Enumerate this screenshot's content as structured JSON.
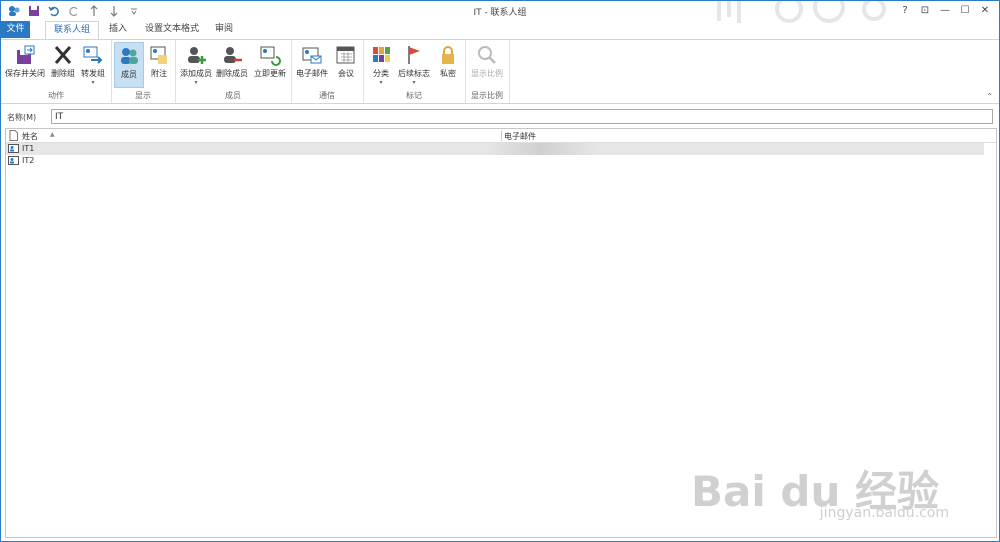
{
  "window_title": "IT - 联系人组",
  "tabs": [
    {
      "label": "文件"
    },
    {
      "label": "联系人组"
    },
    {
      "label": "插入"
    },
    {
      "label": "设置文本格式"
    },
    {
      "label": "审阅"
    }
  ],
  "window_controls": {
    "help": "?",
    "options": "⊡",
    "minimize": "—",
    "maximize": "☐",
    "close": "✕"
  },
  "ribbon": {
    "groups": {
      "actions": {
        "label": "动作",
        "save_close": "保存并关闭",
        "delete_group": "删除组",
        "forward_group": "转发组"
      },
      "show": {
        "label": "显示",
        "members": "成员",
        "notes": "附注"
      },
      "members": {
        "label": "成员",
        "add_members": "添加成员",
        "remove_member": "删除成员",
        "update_now": "立即更新"
      },
      "communicate": {
        "label": "通信",
        "email": "电子邮件",
        "meeting": "会议"
      },
      "tags": {
        "label": "标记",
        "categorize": "分类",
        "follow_up": "后续标志",
        "private": "私密"
      },
      "zoom": {
        "label": "显示比例",
        "zoom": "显示比例"
      }
    }
  },
  "name_field": {
    "label": "名称(M)",
    "value": "IT"
  },
  "list": {
    "columns": {
      "name": "姓名",
      "email": "电子邮件"
    },
    "rows": [
      {
        "name": "IT1"
      },
      {
        "name": "IT2"
      }
    ]
  },
  "watermark": {
    "main": "Bai du 经验",
    "sub": "jingyan.baidu.com"
  },
  "colors": {
    "accent": "#2b79c2",
    "selected": "#c7dff2"
  }
}
